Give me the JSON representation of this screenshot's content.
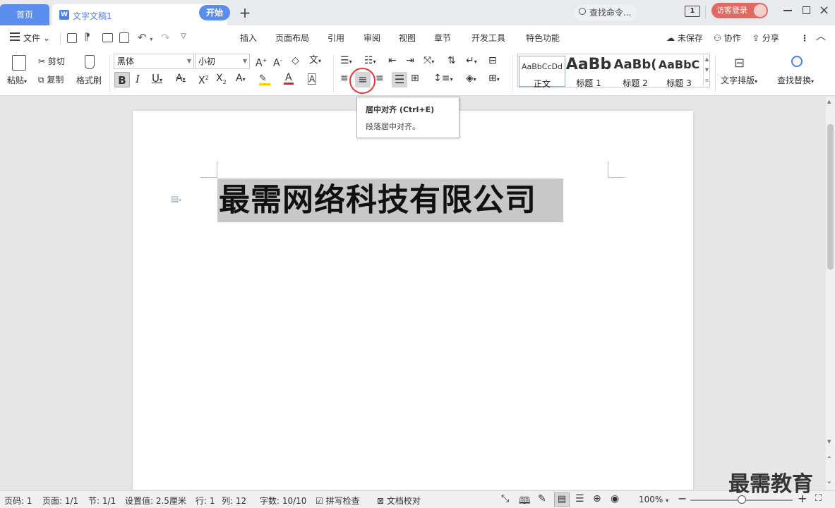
{
  "titlebar": {
    "home_tab": "首页",
    "doc_tab": "文字文稿1",
    "doc_icon_letter": "W",
    "new_tab_symbol": "+",
    "page_count_badge": "1",
    "login_label": "访客登录"
  },
  "menubar": {
    "file_label": "文件",
    "items": [
      "开始",
      "插入",
      "页面布局",
      "引用",
      "审阅",
      "视图",
      "章节",
      "开发工具",
      "特色功能"
    ],
    "search_label": "查找命令...",
    "unsaved": "未保存",
    "collab": "协作",
    "share": "分享"
  },
  "ribbon": {
    "paste_label": "粘贴",
    "cut_label": "剪切",
    "copy_label": "复制",
    "format_painter_label": "格式刷",
    "font_name": "黑体",
    "font_size": "小初",
    "text_layout_label": "文字排版",
    "find_replace_label": "查找替换",
    "styles": [
      {
        "sample": "AaBbCcDd",
        "name": "正文"
      },
      {
        "sample": "AaBb",
        "name": "标题 1"
      },
      {
        "sample": "AaBb(",
        "name": "标题 2"
      },
      {
        "sample": "AaBbC",
        "name": "标题 3"
      }
    ]
  },
  "tooltip": {
    "title": "居中对齐 (Ctrl+E)",
    "desc": "段落居中对齐。"
  },
  "document": {
    "title_text": "最需网络科技有限公司"
  },
  "statusbar": {
    "page_num": "页码: 1",
    "pages": "页面: 1/1",
    "section": "节: 1/1",
    "setting": "设置值: 2.5厘米",
    "row": "行: 1",
    "col": "列: 12",
    "word_count": "字数: 10/10",
    "spell_check": "拼写检查",
    "doc_proof": "文档校对",
    "zoom": "100%",
    "zoom_level": 1.0
  },
  "watermark": "最需教育",
  "colors": {
    "accent": "#5b8def",
    "login": "#e06a63",
    "highlight_ring": "#e53935",
    "selection": "#c8c8c8"
  }
}
